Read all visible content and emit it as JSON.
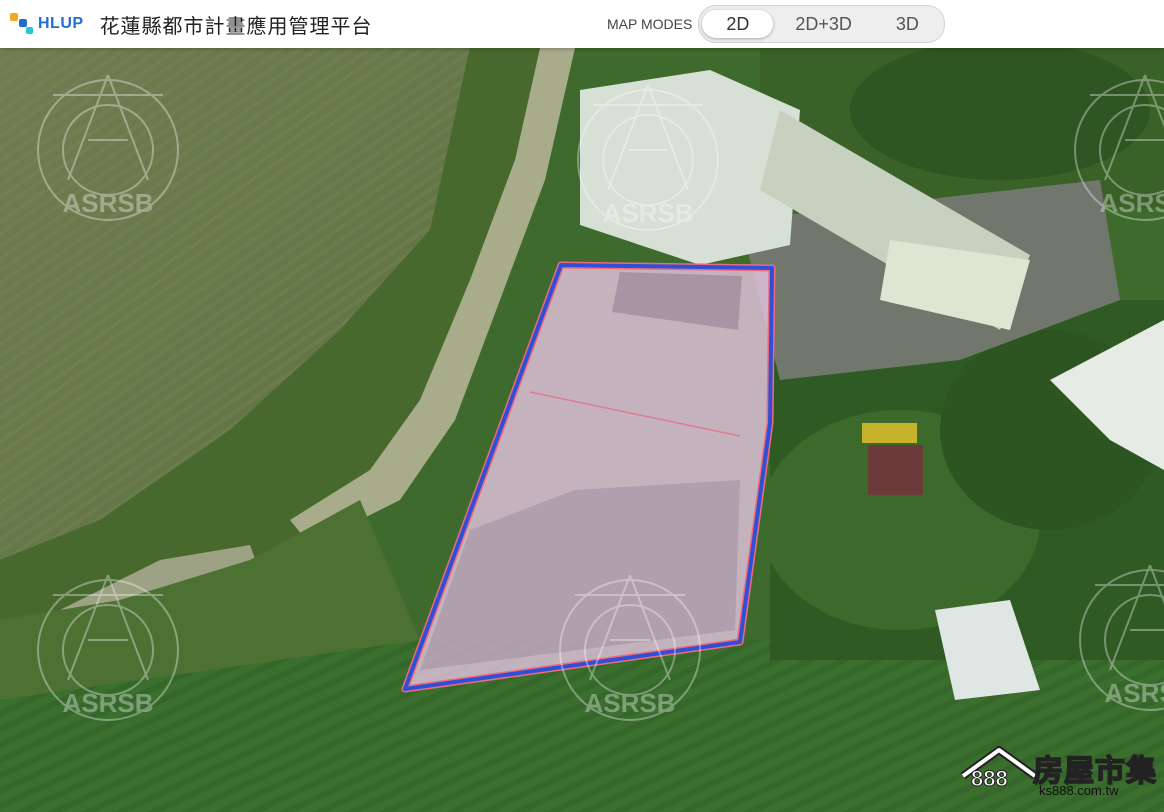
{
  "header": {
    "logo_text": "HLUP",
    "app_title": "花蓮縣都市計畫應用管理平台",
    "modes_label": "MAP MODES",
    "modes": [
      {
        "label": "2D",
        "active": true
      },
      {
        "label": "2D+3D",
        "active": false
      },
      {
        "label": "3D",
        "active": false
      }
    ]
  },
  "map": {
    "watermark_text": "ASRSB",
    "parcel_fill": "#e9c6e6",
    "parcel_border": "#2f4fd6",
    "parcel_outline": "#f06a7a"
  },
  "badge": {
    "number": "888",
    "name": "房屋市集",
    "url": "ks888.com.tw"
  },
  "colors": {
    "accent": "#1e6fd0",
    "logo_squares": [
      "#f5a623",
      "#1e6fd0",
      "#29c4d8"
    ]
  }
}
